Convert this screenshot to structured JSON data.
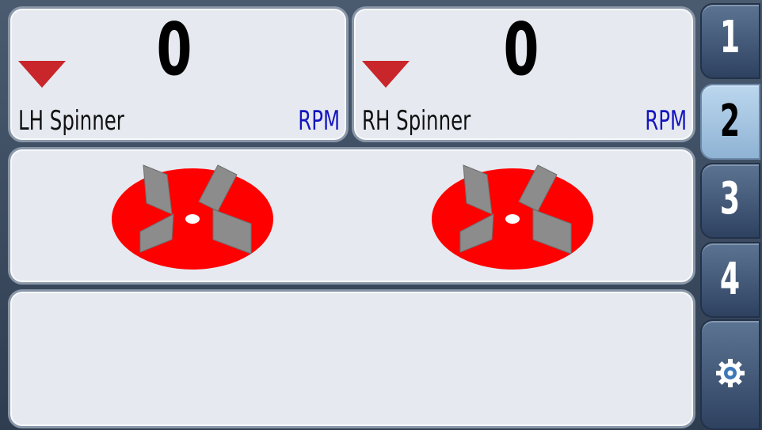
{
  "lh": {
    "value": "0",
    "label": "LH  Spinner",
    "unit": "RPM"
  },
  "rh": {
    "value": "0",
    "label": "RH  Spinner",
    "unit": "RPM"
  },
  "side_buttons": {
    "b1": "1",
    "b2": "2",
    "b3": "3",
    "b4": "4",
    "active": "2",
    "settings_icon": "gear-icon"
  },
  "colors": {
    "spinner_disc": "#ff0000",
    "spinner_blade": "#8c8c8c",
    "arrow": "#c8262b",
    "unit": "#1515c0"
  }
}
